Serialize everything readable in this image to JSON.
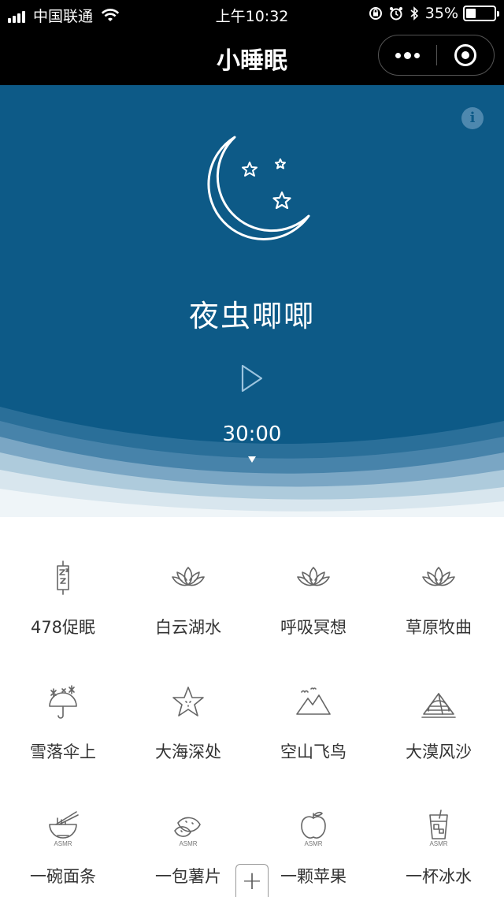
{
  "status_bar": {
    "carrier": "中国联通",
    "time": "上午10:32",
    "battery_percent": "35%",
    "battery_level": 0.35
  },
  "nav": {
    "title": "小睡眠",
    "more_icon": "more-dots-icon",
    "close_icon": "mini-program-close-icon"
  },
  "hero": {
    "track_name": "夜虫唧唧",
    "timer": "30:00",
    "info_icon": "info-icon",
    "illustration": "moon-stars-icon",
    "colors": {
      "background": "#0d5a87",
      "accent": "#4e88ae"
    }
  },
  "grid": {
    "items": [
      {
        "label": "478促眠",
        "icon": "sleep-zzz-icon"
      },
      {
        "label": "白云湖水",
        "icon": "lotus-icon"
      },
      {
        "label": "呼吸冥想",
        "icon": "lotus-icon"
      },
      {
        "label": "草原牧曲",
        "icon": "lotus-icon"
      },
      {
        "label": "雪落伞上",
        "icon": "snow-umbrella-icon"
      },
      {
        "label": "大海深处",
        "icon": "starfish-icon"
      },
      {
        "label": "空山飞鸟",
        "icon": "mountain-birds-icon"
      },
      {
        "label": "大漠风沙",
        "icon": "pyramid-sun-icon"
      },
      {
        "label": "一碗面条",
        "icon": "noodle-bowl-icon",
        "tag": "ASMR"
      },
      {
        "label": "一包薯片",
        "icon": "chips-icon",
        "tag": "ASMR"
      },
      {
        "label": "一颗苹果",
        "icon": "apple-icon",
        "tag": "ASMR"
      },
      {
        "label": "一杯冰水",
        "icon": "ice-water-icon",
        "tag": "ASMR"
      }
    ]
  },
  "fab": {
    "label": "+"
  }
}
